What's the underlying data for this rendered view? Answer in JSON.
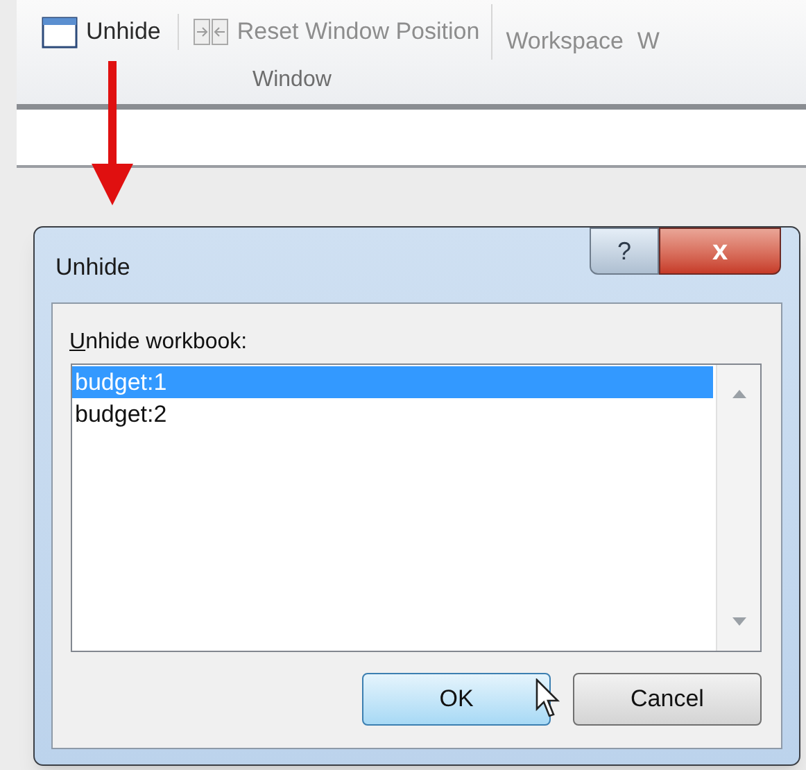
{
  "ribbon": {
    "buttons": [
      {
        "label": "Unhide",
        "disabled": false
      },
      {
        "label": "Reset Window Position",
        "disabled": true
      },
      {
        "label": "Workspace",
        "disabled": true
      },
      {
        "label": "W",
        "disabled": true
      }
    ],
    "group_label": "Window"
  },
  "dialog": {
    "title": "Unhide",
    "help": "?",
    "close": "x",
    "label": "Unhide workbook:",
    "items": [
      {
        "label": "budget:1",
        "selected": true
      },
      {
        "label": "budget:2",
        "selected": false
      }
    ],
    "buttons": [
      {
        "label": "OK",
        "kind": "default"
      },
      {
        "label": "Cancel",
        "kind": "normal"
      }
    ]
  }
}
